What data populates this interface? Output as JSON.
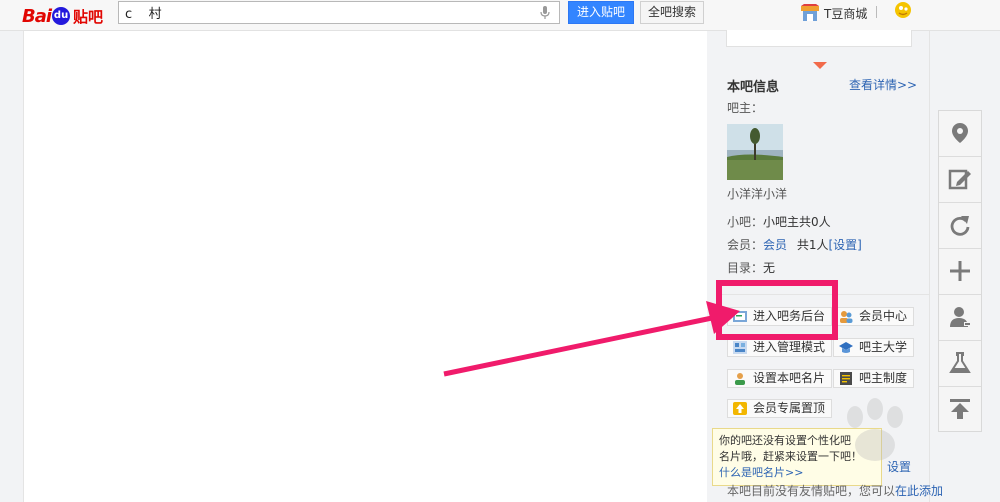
{
  "header": {
    "logo": {
      "bai": "Bai",
      "du": "du",
      "tieba": "贴吧"
    },
    "search": {
      "value": "c    村",
      "placeholder": ""
    },
    "enter_button": "进入贴吧",
    "all_search_button": "全吧搜索",
    "mall_label": "T豆商城",
    "icons": {
      "mic": "microphone-icon",
      "mall": "shop-icon",
      "user": "user-badge-icon"
    }
  },
  "sidebar": {
    "info_title": "本吧信息",
    "details_link": "查看详情>>",
    "owner_label": "吧主：",
    "owner_name": "小洋洋小洋",
    "small_owner": {
      "label": "小吧：",
      "value": "小吧主共0人"
    },
    "members": {
      "label": "会员：",
      "link": "会员",
      "count": "共1人",
      "settings": "[设置]"
    },
    "catalog": {
      "label": "目录：",
      "value": "无"
    },
    "tools": [
      {
        "label": "进入吧务后台",
        "icon": "admin-panel-icon"
      },
      {
        "label": "会员中心",
        "icon": "members-icon"
      },
      {
        "label": "进入管理模式",
        "icon": "manage-mode-icon"
      },
      {
        "label": "吧主大学",
        "icon": "graduation-cap-icon"
      },
      {
        "label": "设置本吧名片",
        "icon": "card-user-icon"
      },
      {
        "label": "吧主制度",
        "icon": "rules-icon"
      },
      {
        "label": "会员专属置顶",
        "icon": "pin-top-icon"
      }
    ],
    "tooltip": {
      "line1": "你的吧还没有设置个性化吧",
      "line2": "名片哦，赶紧来设置一下吧！",
      "link": "什么是吧名片>>"
    },
    "settings_link": "设置",
    "bottom_note": {
      "text": "本吧目前没有友情贴吧，您可以",
      "link": "在此添加"
    }
  },
  "right_toolbar": {
    "buttons": [
      {
        "icon": "location-pin-icon"
      },
      {
        "icon": "edit-icon"
      },
      {
        "icon": "refresh-icon"
      },
      {
        "icon": "plus-icon"
      },
      {
        "icon": "user-plus-icon"
      },
      {
        "icon": "flask-icon"
      },
      {
        "icon": "back-to-top-icon"
      }
    ]
  },
  "colors": {
    "accent_blue": "#3385ff",
    "link_blue": "#2d64b3",
    "logo_red": "#e10602",
    "highlight_pink": "#f01b6b",
    "tooltip_bg": "#fffde6"
  }
}
